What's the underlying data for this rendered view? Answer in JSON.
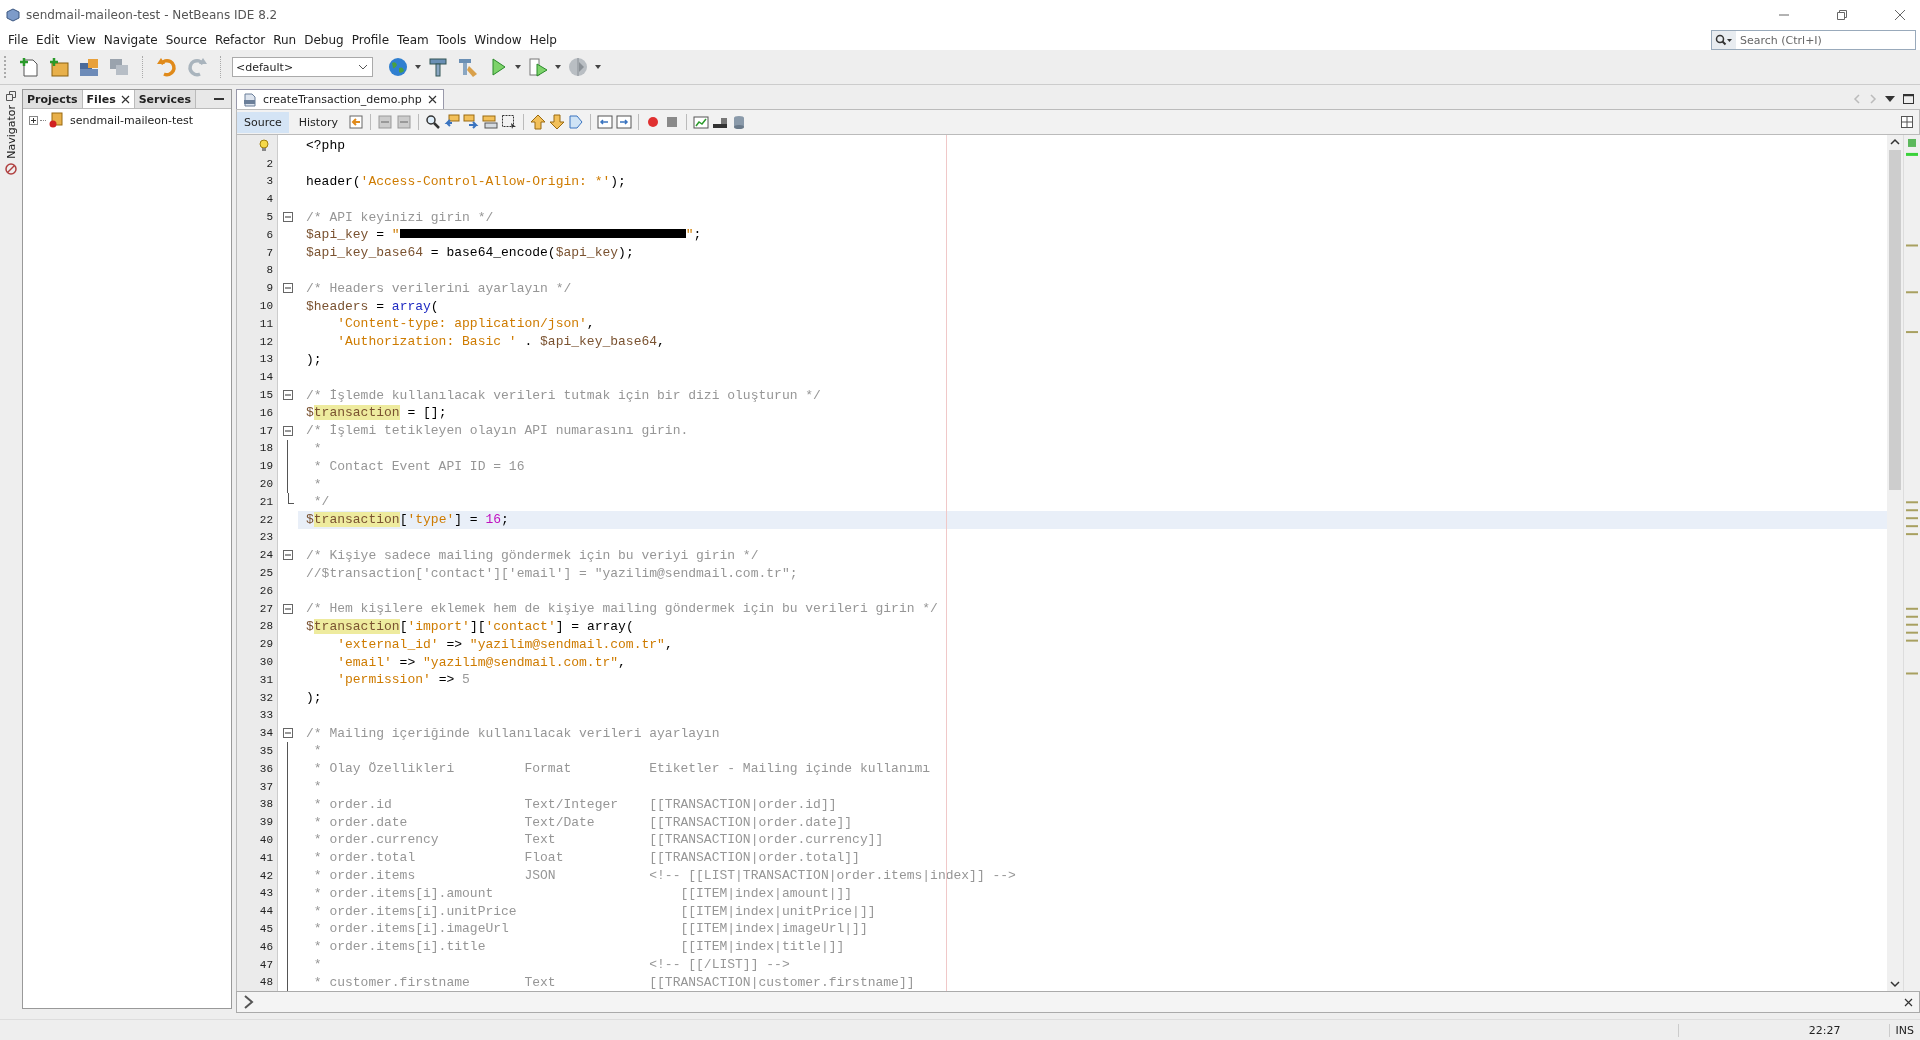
{
  "window": {
    "title": "sendmail-maileon-test - NetBeans IDE 8.2"
  },
  "menu": [
    "File",
    "Edit",
    "View",
    "Navigate",
    "Source",
    "Refactor",
    "Run",
    "Debug",
    "Profile",
    "Team",
    "Tools",
    "Window",
    "Help"
  ],
  "search": {
    "placeholder": "Search (Ctrl+I)"
  },
  "toolbar": {
    "configuration": "<default>"
  },
  "navigator": {
    "label": "Navigator"
  },
  "side_tabs": [
    {
      "label": "Projects",
      "selected": false,
      "closable": false
    },
    {
      "label": "Files",
      "selected": true,
      "closable": true
    },
    {
      "label": "Services",
      "selected": false,
      "closable": false
    }
  ],
  "project_tree": [
    {
      "label": "sendmail-maileon-test",
      "expanded": false,
      "error": true
    }
  ],
  "editor_tab": {
    "label": "createTransaction_demo.php"
  },
  "view_tabs": [
    {
      "label": "Source",
      "selected": true
    },
    {
      "label": "History",
      "selected": false
    }
  ],
  "code_lines": [
    {
      "current": false,
      "hint": true,
      "t": [
        {
          "kind": "plain",
          "text": "<?php"
        }
      ]
    },
    {
      "n": "2",
      "current": false
    },
    {
      "n": "3",
      "current": false,
      "t": [
        {
          "kind": "plain",
          "text": "header("
        },
        {
          "kind": "str",
          "text": "'Access-Control-Allow-Origin: *'"
        },
        {
          "kind": "plain",
          "text": ");"
        }
      ]
    },
    {
      "n": "4",
      "current": false
    },
    {
      "n": "5",
      "current": false,
      "fold_start": true,
      "t": [
        {
          "kind": "com",
          "text": "/* API keyinizi girin */"
        }
      ]
    },
    {
      "n": "6",
      "current": false,
      "t": [
        {
          "kind": "var",
          "text": "$api_key"
        },
        {
          "kind": "plain",
          "text": " = "
        },
        {
          "kind": "str",
          "text": "\""
        },
        {
          "kind": "redacted"
        },
        {
          "kind": "str",
          "text": "\""
        },
        {
          "kind": "plain",
          "text": ";"
        }
      ]
    },
    {
      "n": "7",
      "current": false,
      "t": [
        {
          "kind": "var",
          "text": "$api_key_base64"
        },
        {
          "kind": "plain",
          "text": " = base64_encode("
        },
        {
          "kind": "var",
          "text": "$api_key"
        },
        {
          "kind": "plain",
          "text": ");"
        }
      ]
    },
    {
      "n": "8",
      "current": false
    },
    {
      "n": "9",
      "current": false,
      "fold_start": true,
      "t": [
        {
          "kind": "com",
          "text": "/* Headers verilerini ayarlayın */"
        }
      ]
    },
    {
      "n": "10",
      "current": false,
      "t": [
        {
          "kind": "var",
          "text": "$headers"
        },
        {
          "kind": "plain",
          "text": " = "
        },
        {
          "kind": "kw",
          "text": "array"
        },
        {
          "kind": "plain",
          "text": "("
        }
      ]
    },
    {
      "n": "11",
      "current": false,
      "indent": true,
      "t": [
        {
          "kind": "str",
          "text": "'Content-type: application/json'"
        },
        {
          "kind": "plain",
          "text": ","
        }
      ]
    },
    {
      "n": "12",
      "current": false,
      "indent": true,
      "t": [
        {
          "kind": "str",
          "text": "'Authorization: Basic '"
        },
        {
          "kind": "plain",
          "text": " . "
        },
        {
          "kind": "var",
          "text": "$api_key_base64"
        },
        {
          "kind": "plain",
          "text": ","
        }
      ]
    },
    {
      "n": "13",
      "current": false,
      "t": [
        {
          "kind": "plain",
          "text": ");"
        }
      ]
    },
    {
      "n": "14",
      "current": false
    },
    {
      "n": "15",
      "current": false,
      "fold_start": true,
      "t": [
        {
          "kind": "com",
          "text": "/* İşlemde kullanılacak verileri tutmak için bir dizi oluşturun */"
        }
      ]
    },
    {
      "n": "16",
      "current": false,
      "t": [
        {
          "kind": "var",
          "text": "$"
        },
        {
          "kind": "hl",
          "text": "transaction"
        },
        {
          "kind": "plain",
          "text": " = [];"
        }
      ]
    },
    {
      "n": "17",
      "current": false,
      "fold_start": true,
      "t": [
        {
          "kind": "com",
          "text": "/* İşlemi tetikleyen olayın API numarasını girin."
        }
      ]
    },
    {
      "n": "18",
      "current": false,
      "fold_line": true,
      "t": [
        {
          "kind": "com",
          "text": " *"
        }
      ]
    },
    {
      "n": "19",
      "current": false,
      "fold_line": true,
      "t": [
        {
          "kind": "com",
          "text": " * Contact Event API ID = 16"
        }
      ]
    },
    {
      "n": "20",
      "current": false,
      "fold_line": true,
      "t": [
        {
          "kind": "com",
          "text": " *"
        }
      ]
    },
    {
      "n": "21",
      "current": false,
      "fold_end": true,
      "t": [
        {
          "kind": "com",
          "text": " */"
        }
      ]
    },
    {
      "n": "22",
      "current": true,
      "t": [
        {
          "kind": "var",
          "text": "$"
        },
        {
          "kind": "hl",
          "text": "transaction"
        },
        {
          "kind": "plain",
          "text": "["
        },
        {
          "kind": "str",
          "text": "'type'"
        },
        {
          "kind": "plain",
          "text": "] = "
        },
        {
          "kind": "num",
          "text": "16"
        },
        {
          "kind": "plain",
          "text": ";"
        }
      ]
    },
    {
      "n": "23",
      "current": false
    },
    {
      "n": "24",
      "current": false,
      "fold_start": true,
      "t": [
        {
          "kind": "com",
          "text": "/* Kişiye sadece mailing göndermek için bu veriyi girin */"
        }
      ]
    },
    {
      "n": "25",
      "current": false,
      "t": [
        {
          "kind": "com",
          "text": "//$transaction['contact']['email'] = \"yazilim@sendmail.com.tr\";"
        }
      ]
    },
    {
      "n": "26",
      "current": false
    },
    {
      "n": "27",
      "current": false,
      "fold_start": true,
      "t": [
        {
          "kind": "com",
          "text": "/* Hem kişilere eklemek hem de kişiye mailing göndermek için bu verileri girin */"
        }
      ]
    },
    {
      "n": "28",
      "current": false,
      "t": [
        {
          "kind": "var",
          "text": "$"
        },
        {
          "kind": "hl",
          "text": "transaction"
        },
        {
          "kind": "plain",
          "text": "["
        },
        {
          "kind": "str",
          "text": "'import'"
        },
        {
          "kind": "plain",
          "text": "]["
        },
        {
          "kind": "str",
          "text": "'contact'"
        },
        {
          "kind": "plain",
          "text": "] = array("
        }
      ]
    },
    {
      "n": "29",
      "current": false,
      "indent": true,
      "t": [
        {
          "kind": "str",
          "text": "'external_id'"
        },
        {
          "kind": "plain",
          "text": " => "
        },
        {
          "kind": "str",
          "text": "\"yazilim@sendmail.com.tr\""
        },
        {
          "kind": "plain",
          "text": ","
        }
      ]
    },
    {
      "n": "30",
      "current": false,
      "indent": true,
      "t": [
        {
          "kind": "str",
          "text": "'email'"
        },
        {
          "kind": "plain",
          "text": " => "
        },
        {
          "kind": "str",
          "text": "\"yazilim@sendmail.com.tr\""
        },
        {
          "kind": "plain",
          "text": ","
        }
      ]
    },
    {
      "n": "31",
      "current": false,
      "indent": true,
      "t": [
        {
          "kind": "str",
          "text": "'permission'"
        },
        {
          "kind": "plain",
          "text": " => "
        },
        {
          "kind": "dim",
          "text": "5"
        }
      ]
    },
    {
      "n": "32",
      "current": false,
      "t": [
        {
          "kind": "plain",
          "text": ");"
        }
      ]
    },
    {
      "n": "33",
      "current": false
    },
    {
      "n": "34",
      "current": false,
      "fold_start": true,
      "t": [
        {
          "kind": "com",
          "text": "/* Mailing içeriğinde kullanılacak verileri ayarlayın"
        }
      ]
    },
    {
      "n": "35",
      "current": false,
      "fold_line": true,
      "t": [
        {
          "kind": "com",
          "text": " *"
        }
      ]
    },
    {
      "n": "36",
      "current": false,
      "fold_line": true,
      "t": [
        {
          "kind": "com",
          "text": " * Olay Özellikleri         Format          Etiketler - Mailing içinde kullanımı"
        }
      ]
    },
    {
      "n": "37",
      "current": false,
      "fold_line": true,
      "t": [
        {
          "kind": "com",
          "text": " *"
        }
      ]
    },
    {
      "n": "38",
      "current": false,
      "fold_line": true,
      "t": [
        {
          "kind": "com",
          "text": " * order.id                 Text/Integer    [[TRANSACTION|order.id]]"
        }
      ]
    },
    {
      "n": "39",
      "current": false,
      "fold_line": true,
      "t": [
        {
          "kind": "com",
          "text": " * order.date               Text/Date       [[TRANSACTION|order.date]]"
        }
      ]
    },
    {
      "n": "40",
      "current": false,
      "fold_line": true,
      "t": [
        {
          "kind": "com",
          "text": " * order.currency           Text            [[TRANSACTION|order.currency]]"
        }
      ]
    },
    {
      "n": "41",
      "current": false,
      "fold_line": true,
      "t": [
        {
          "kind": "com",
          "text": " * order.total              Float           [[TRANSACTION|order.total]]"
        }
      ]
    },
    {
      "n": "42",
      "current": false,
      "fold_line": true,
      "t": [
        {
          "kind": "com",
          "text": " * order.items              JSON            <!-- [[LIST|TRANSACTION|order.items|index]] -->"
        }
      ]
    },
    {
      "n": "43",
      "current": false,
      "fold_line": true,
      "t": [
        {
          "kind": "com",
          "text": " * order.items[i].amount                        [[ITEM|index|amount|]]"
        }
      ]
    },
    {
      "n": "44",
      "current": false,
      "fold_line": true,
      "t": [
        {
          "kind": "com",
          "text": " * order.items[i].unitPrice                     [[ITEM|index|unitPrice|]]"
        }
      ]
    },
    {
      "n": "45",
      "current": false,
      "fold_line": true,
      "t": [
        {
          "kind": "com",
          "text": " * order.items[i].imageUrl                      [[ITEM|index|imageUrl|]]"
        }
      ]
    },
    {
      "n": "46",
      "current": false,
      "fold_line": true,
      "t": [
        {
          "kind": "com",
          "text": " * order.items[i].title                         [[ITEM|index|title|]]"
        }
      ]
    },
    {
      "n": "47",
      "current": false,
      "fold_line": true,
      "t": [
        {
          "kind": "com",
          "text": " *                                          <!-- [[/LIST]] -->"
        }
      ]
    },
    {
      "n": "48",
      "current": false,
      "fold_line": true,
      "t": [
        {
          "kind": "com",
          "text": " * customer.firstname       Text            [[TRANSACTION|customer.firstname]]"
        }
      ]
    }
  ],
  "status_bar": {
    "position": "22:27",
    "mode": "INS"
  }
}
